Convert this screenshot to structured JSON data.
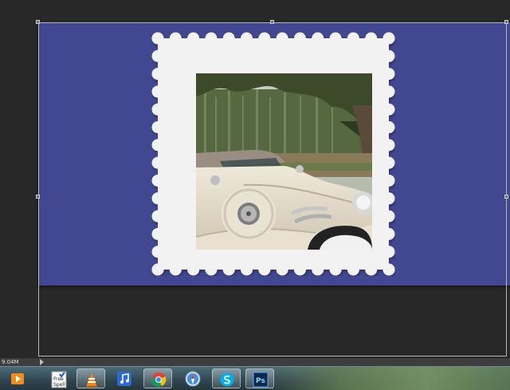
{
  "status": {
    "doc_size": "9.04M"
  },
  "taskbar": {
    "items": [
      {
        "name": "media-player-icon"
      },
      {
        "name": "freespell-icon",
        "label_line1": "Free",
        "label_line2": "Spell"
      },
      {
        "name": "vlc-icon"
      },
      {
        "name": "itunes-icon"
      },
      {
        "name": "chrome-icon"
      },
      {
        "name": "safari-icon"
      },
      {
        "name": "skype-icon"
      },
      {
        "name": "photoshop-icon",
        "label": "Ps"
      }
    ]
  },
  "colors": {
    "canvas_bg": "#414791",
    "stamp": "#f2f2f2",
    "workspace": "#282828"
  }
}
